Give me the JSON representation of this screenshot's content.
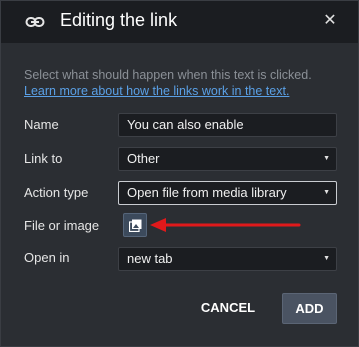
{
  "dialog": {
    "title": "Editing the link",
    "close_glyph": "✕",
    "header_icon": "link-icon"
  },
  "description": {
    "text": "Select what should happen when this text is clicked.",
    "learn_link": "Learn more about how the links work in the text."
  },
  "form": {
    "name_label": "Name",
    "name_value": "You can also enable",
    "link_to_label": "Link to",
    "link_to_value": "Other",
    "action_type_label": "Action type",
    "action_type_value": "Open file from media library",
    "file_label": "File or image",
    "file_button_icon": "media-library-icon",
    "open_in_label": "Open in",
    "open_in_value": "new tab"
  },
  "buttons": {
    "cancel": "CANCEL",
    "add": "ADD"
  },
  "colors": {
    "annotation_arrow": "#e0191b",
    "link": "#5aa0e6",
    "header_bg": "#1b1d21",
    "dialog_bg": "#2b2e33"
  }
}
